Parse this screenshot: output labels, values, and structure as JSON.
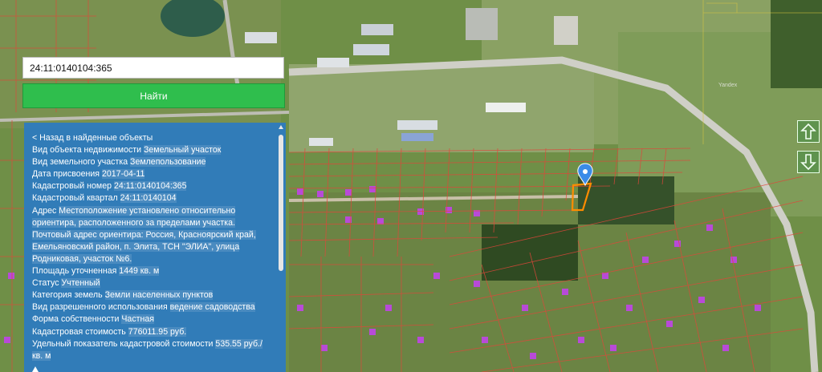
{
  "search": {
    "value": "24:11:0140104:365"
  },
  "find_button": {
    "label": "Найти"
  },
  "panel": {
    "back_link": "< Назад в найденные объекты",
    "fields": [
      {
        "label": "Вид объекта недвижимости",
        "value": "Земельный участок"
      },
      {
        "label": "Вид земельного участка",
        "value": "Землепользование"
      },
      {
        "label": "Дата присвоения",
        "value": "2017-04-11"
      },
      {
        "label": "Кадастровый номер",
        "value": "24:11:0140104:365"
      },
      {
        "label": "Кадастровый квартал",
        "value": "24:11:0140104"
      },
      {
        "label": "Адрес",
        "value": "Местоположение установлено относительно ориентира, расположенного за пределами участка. Почтовый адрес ориентира: Россия, Красноярский край, Емельяновский район, п. Элита, ТСН \"ЭЛИА\", улица Родниковая, участок №6."
      },
      {
        "label": "Площадь уточненная",
        "value": "1449 кв. м"
      },
      {
        "label": "Статус",
        "value": "Учтенный"
      },
      {
        "label": "Категория земель",
        "value": "Земли населенных пунктов"
      },
      {
        "label": "Вид разрешенного использования",
        "value": "ведение садоводства"
      },
      {
        "label": "Форма собственности",
        "value": "Частная"
      },
      {
        "label": "Кадастровая стоимость",
        "value": "776011.95 руб."
      },
      {
        "label": "Удельный показатель кадастровой стоимости",
        "value": "535.55 руб./кв. м"
      }
    ]
  },
  "map": {
    "watermark": "Yandex",
    "parcel_color": "#ff8c00",
    "marker_color": "#3a8be8",
    "grid_color": "#e0463a"
  }
}
